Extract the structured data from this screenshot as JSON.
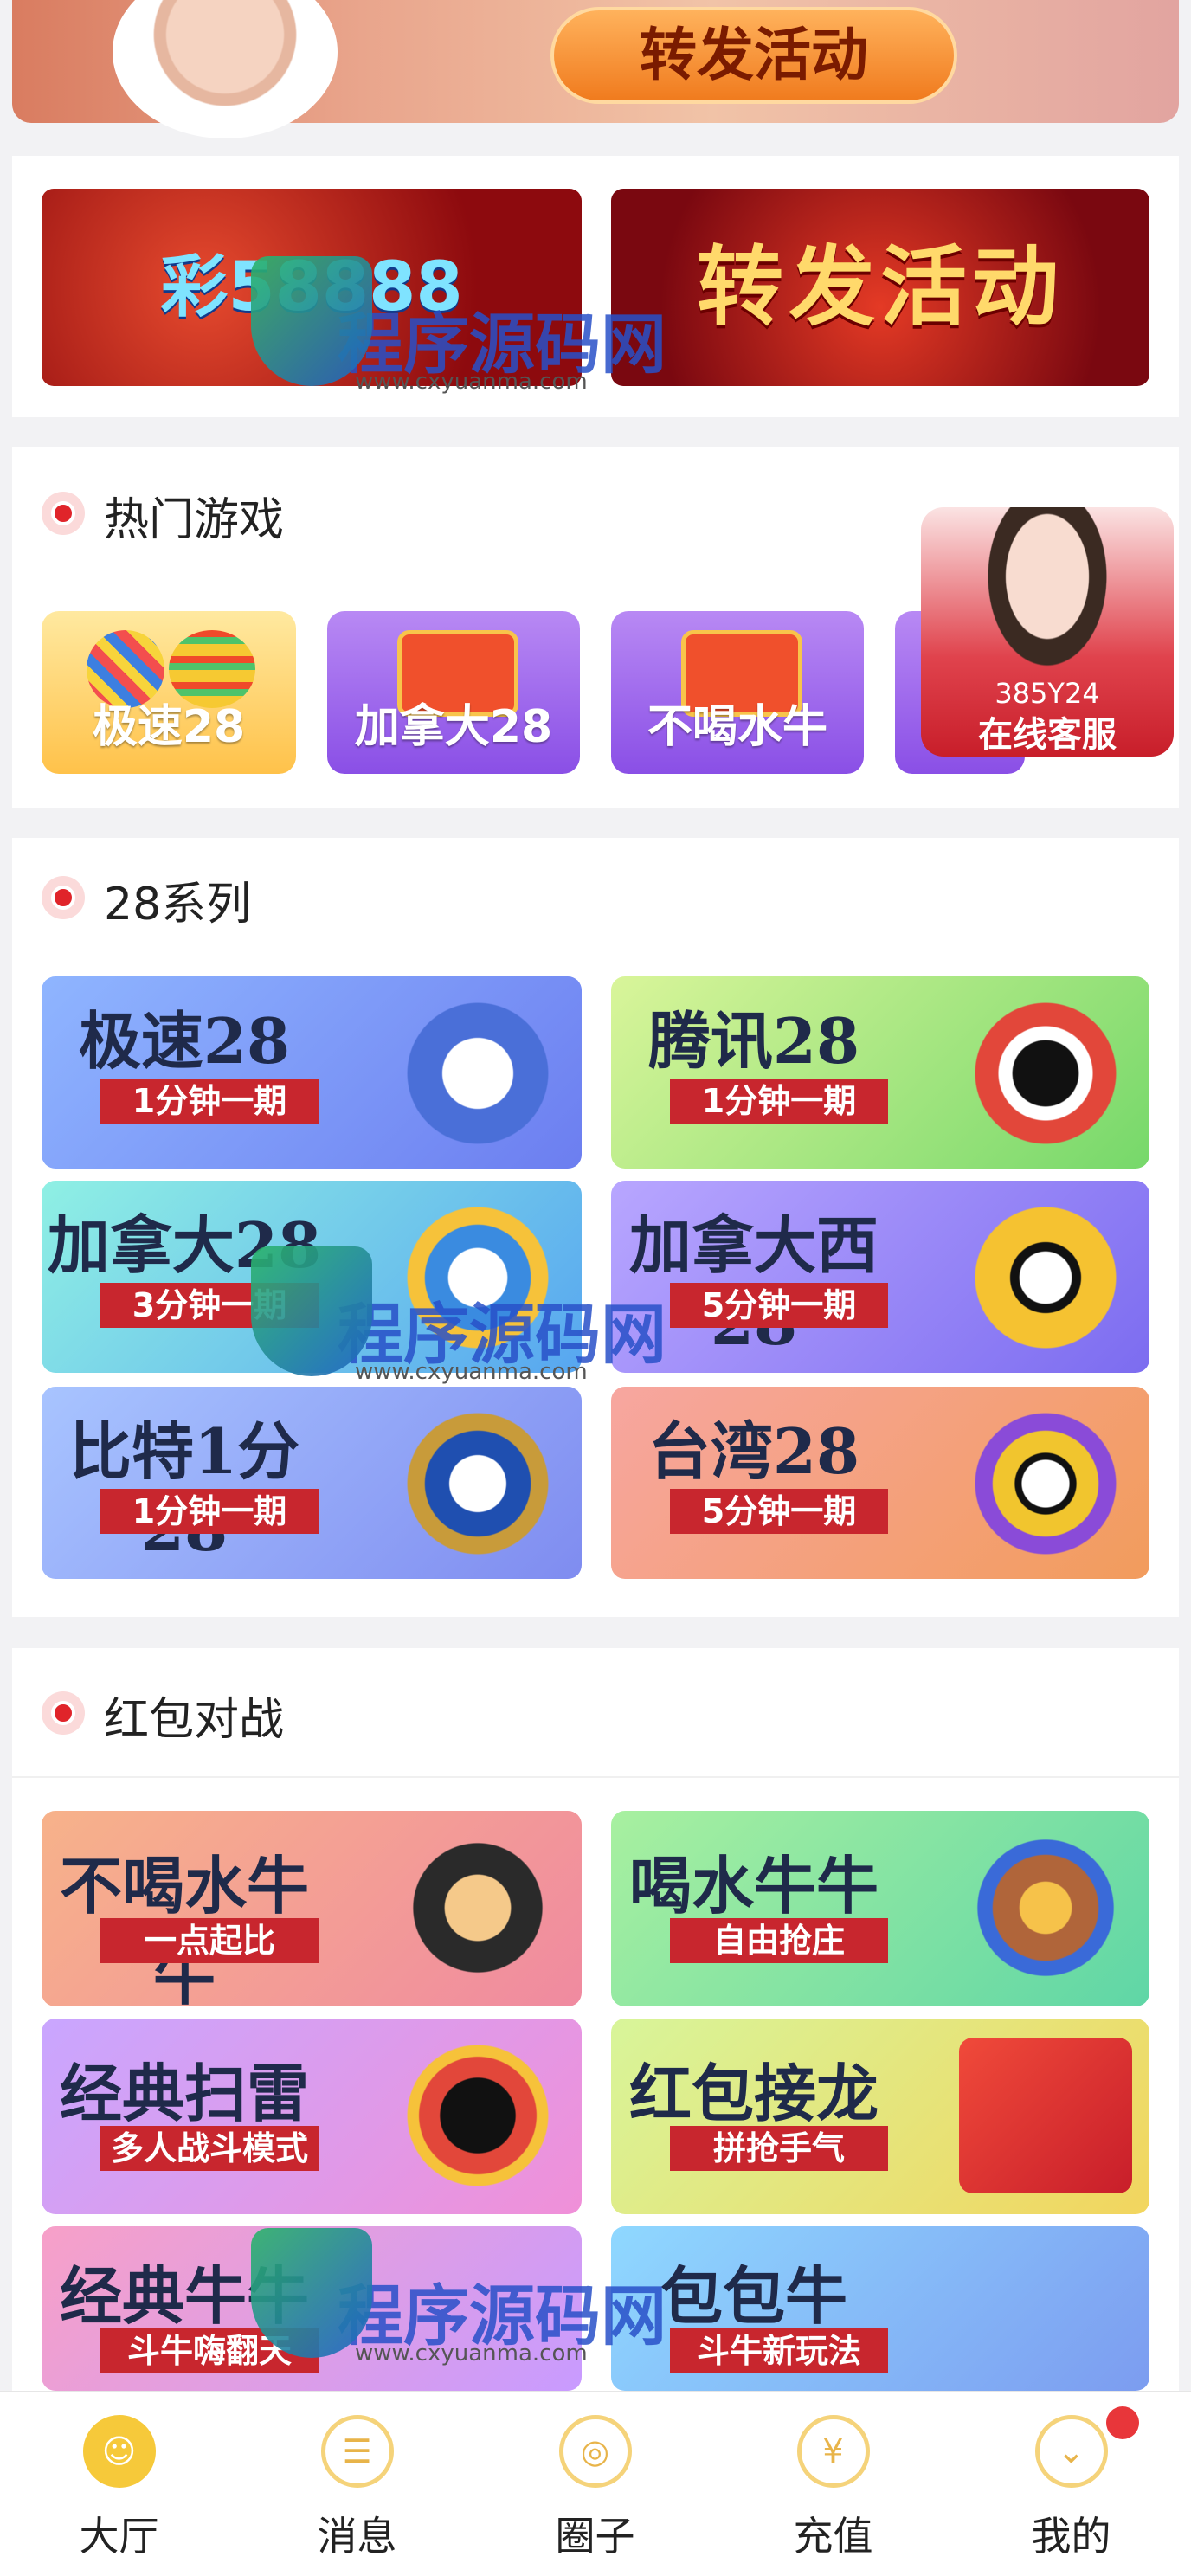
{
  "top_banner": {
    "button_label": "转发活动"
  },
  "promos": [
    {
      "text": "彩58888"
    },
    {
      "text": "转发活动"
    }
  ],
  "watermark": {
    "text": "程序源码网",
    "url": "www.cxyuanma.com"
  },
  "hot_games": {
    "title": "热门游戏",
    "items": [
      {
        "label": "极速28"
      },
      {
        "label": "加拿大28"
      },
      {
        "label": "不喝水牛"
      }
    ]
  },
  "customer_service": {
    "count": "385Y24",
    "label": "在线客服"
  },
  "series_28": {
    "title": "28系列",
    "items": [
      {
        "name": "极速28",
        "tag": "1分钟一期"
      },
      {
        "name": "腾讯28",
        "tag": "1分钟一期"
      },
      {
        "name": "加拿大28",
        "tag": "3分钟一期"
      },
      {
        "name": "加拿大西28",
        "tag": "5分钟一期"
      },
      {
        "name": "比特1分28",
        "tag": "1分钟一期"
      },
      {
        "name": "台湾28",
        "tag": "5分钟一期"
      }
    ]
  },
  "red_packet": {
    "title": "红包对战",
    "items": [
      {
        "name": "不喝水牛牛",
        "tag": "一点起比"
      },
      {
        "name": "喝水牛牛",
        "tag": "自由抢庄"
      },
      {
        "name": "经典扫雷",
        "tag": "多人战斗模式"
      },
      {
        "name": "红包接龙",
        "tag": "拼抢手气"
      },
      {
        "name": "经典牛牛",
        "tag": "斗牛嗨翻天"
      },
      {
        "name": "包包牛",
        "tag": "斗牛新玩法"
      }
    ]
  },
  "tabbar": {
    "items": [
      {
        "label": "大厅",
        "icon": "smile-icon"
      },
      {
        "label": "消息",
        "icon": "message-icon"
      },
      {
        "label": "圈子",
        "icon": "circle-icon"
      },
      {
        "label": "充值",
        "icon": "recharge-icon"
      },
      {
        "label": "我的",
        "icon": "profile-icon"
      }
    ]
  }
}
